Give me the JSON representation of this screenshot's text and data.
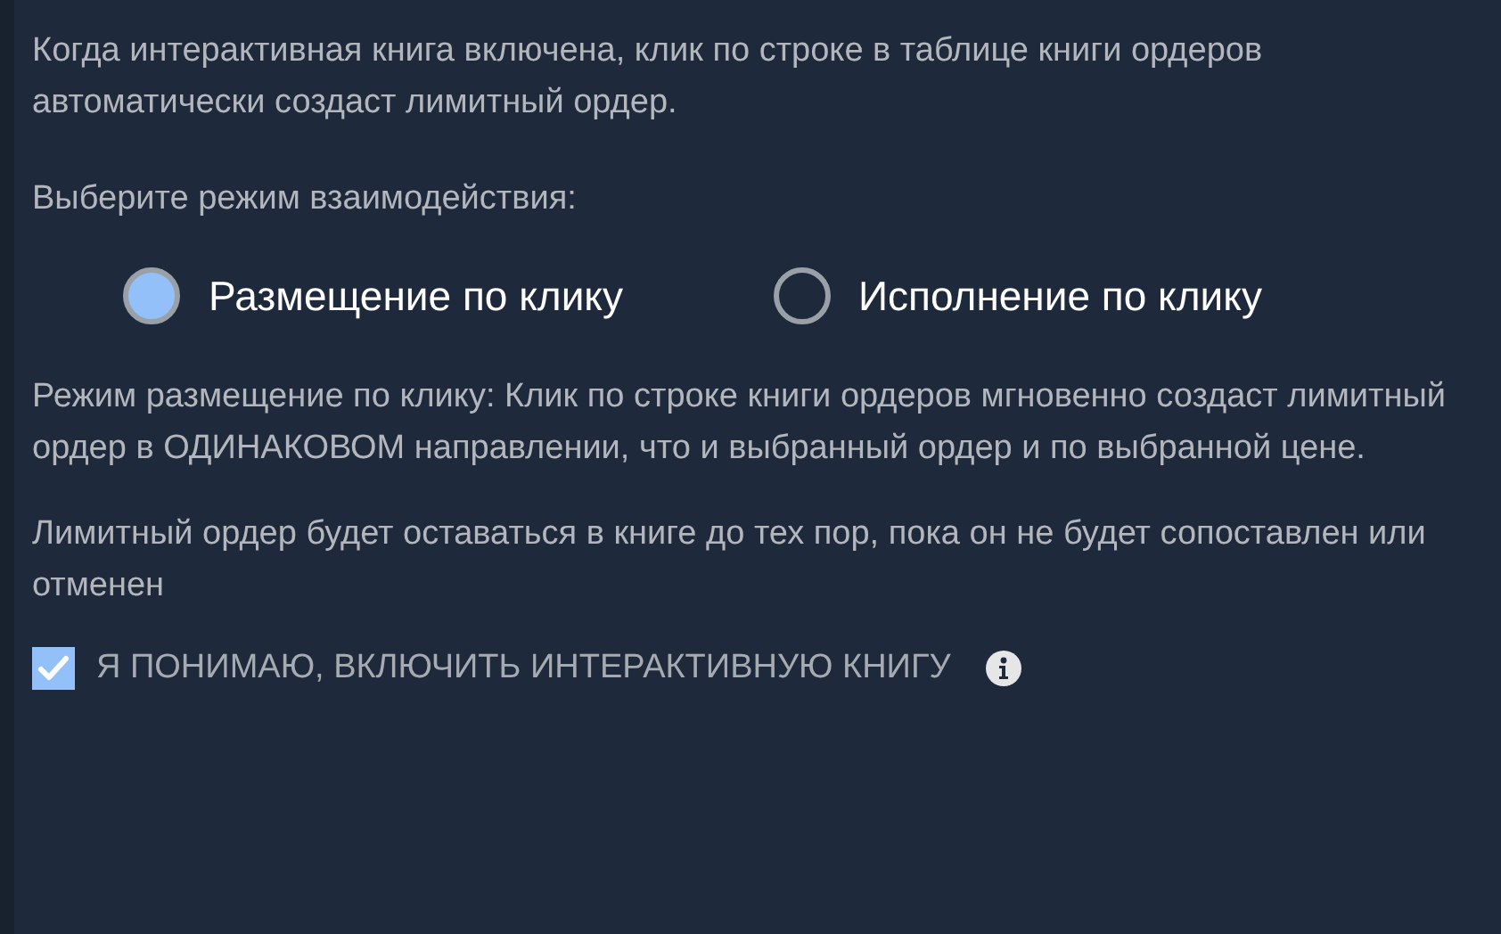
{
  "intro": "Когда интерактивная книга включена, клик по строке в таблице книги ордеров автоматически создаст лимитный ордер.",
  "mode_prompt": "Выберите режим взаимодействия:",
  "modes": [
    {
      "label": "Размещение по клику",
      "selected": true
    },
    {
      "label": "Исполнение по клику",
      "selected": false
    }
  ],
  "mode_description": "Режим размещение по клику: Клик по строке книги ордеров мгновенно создаст лимитный ордер в ОДИНАКОВОМ направлении, что и выбранный ордер и по выбранной цене.",
  "note": "Лимитный ордер будет оставаться в книге до тех пор, пока он не будет сопоставлен или отменен",
  "consent": {
    "label": "Я ПОНИМАЮ, ВКЛЮЧИТЬ ИНТЕРАКТИВНУЮ КНИГУ",
    "checked": true
  }
}
